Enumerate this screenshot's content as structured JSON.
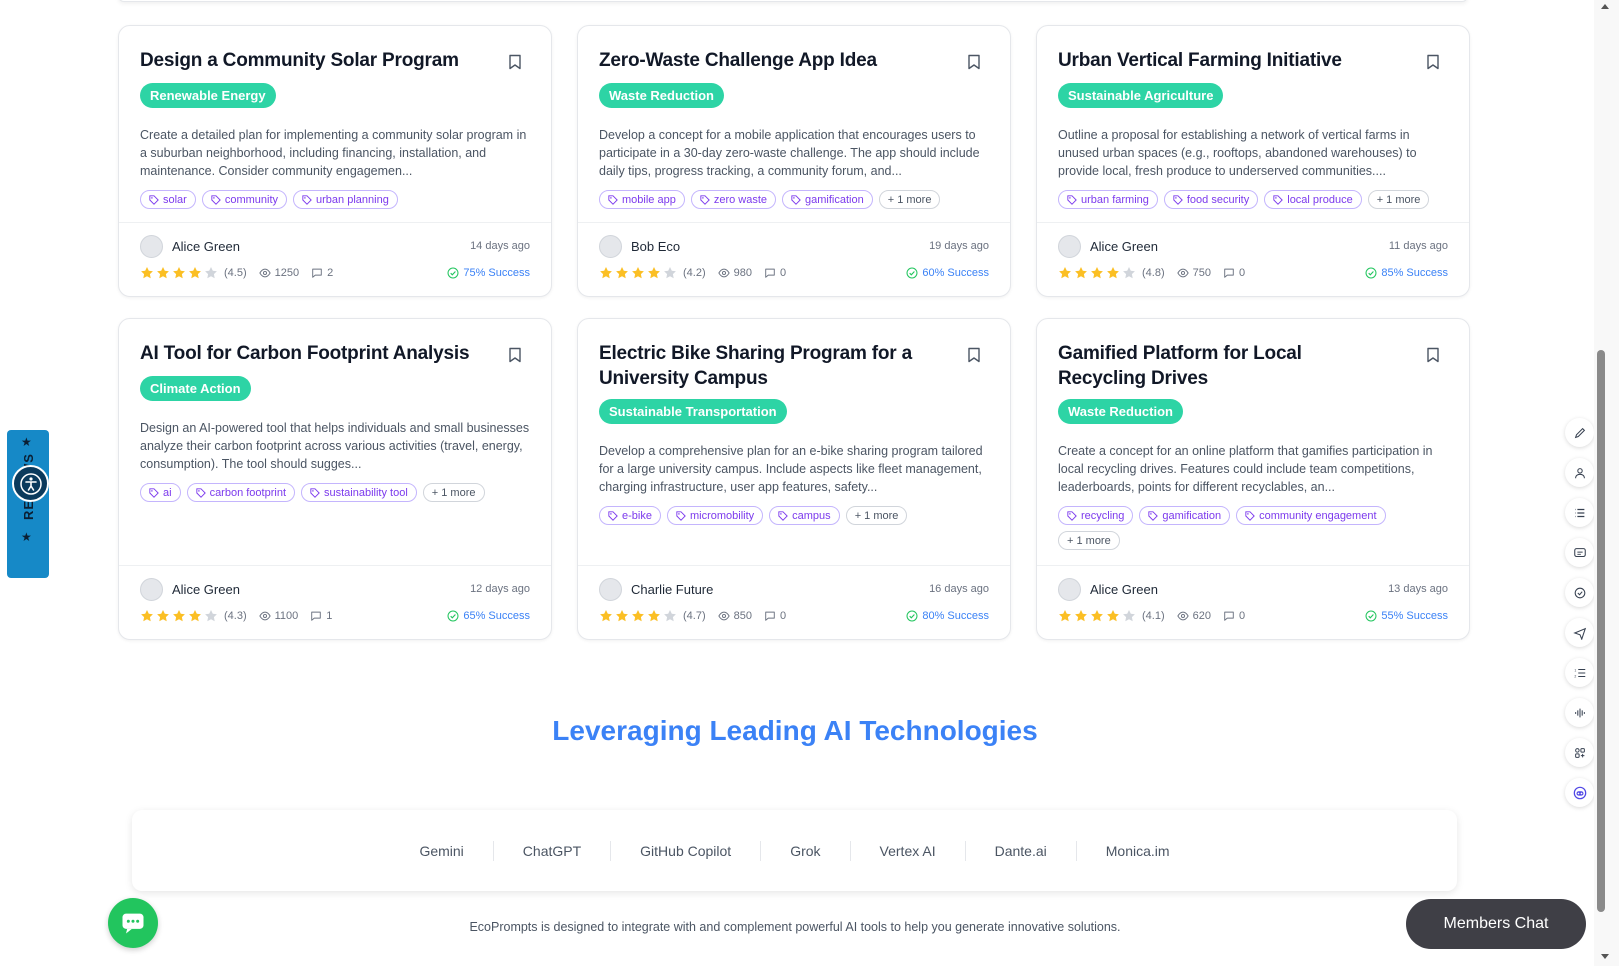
{
  "cards": [
    {
      "title": "Design a Community Solar Program",
      "category": "Renewable Energy",
      "description": "Create a detailed plan for implementing a community solar program in a suburban neighborhood, including financing, installation, and maintenance. Consider community engagemen...",
      "tags": [
        "solar",
        "community",
        "urban planning"
      ],
      "more": "",
      "author": "Alice Green",
      "date": "14 days ago",
      "rating": 4.5,
      "rating_label": "(4.5)",
      "views": "1250",
      "comments": "2",
      "success": "75% Success"
    },
    {
      "title": "Zero-Waste Challenge App Idea",
      "category": "Waste Reduction",
      "description": "Develop a concept for a mobile application that encourages users to participate in a 30-day zero-waste challenge. The app should include daily tips, progress tracking, a community forum, and...",
      "tags": [
        "mobile app",
        "zero waste",
        "gamification"
      ],
      "more": "+ 1 more",
      "author": "Bob Eco",
      "date": "19 days ago",
      "rating": 4.2,
      "rating_label": "(4.2)",
      "views": "980",
      "comments": "0",
      "success": "60% Success"
    },
    {
      "title": "Urban Vertical Farming Initiative",
      "category": "Sustainable Agriculture",
      "description": "Outline a proposal for establishing a network of vertical farms in unused urban spaces (e.g., rooftops, abandoned warehouses) to provide local, fresh produce to underserved communities....",
      "tags": [
        "urban farming",
        "food security",
        "local produce"
      ],
      "more": "+ 1 more",
      "author": "Alice Green",
      "date": "11 days ago",
      "rating": 4.8,
      "rating_label": "(4.8)",
      "views": "750",
      "comments": "0",
      "success": "85% Success"
    },
    {
      "title": "AI Tool for Carbon Footprint Analysis",
      "category": "Climate Action",
      "description": "Design an AI-powered tool that helps individuals and small businesses analyze their carbon footprint across various activities (travel, energy, consumption). The tool should sugges...",
      "tags": [
        "ai",
        "carbon footprint",
        "sustainability tool"
      ],
      "more": "+ 1 more",
      "author": "Alice Green",
      "date": "12 days ago",
      "rating": 4.3,
      "rating_label": "(4.3)",
      "views": "1100",
      "comments": "1",
      "success": "65% Success"
    },
    {
      "title": "Electric Bike Sharing Program for a University Campus",
      "category": "Sustainable Transportation",
      "description": "Develop a comprehensive plan for an e-bike sharing program tailored for a large university campus. Include aspects like fleet management, charging infrastructure, user app features, safety...",
      "tags": [
        "e-bike",
        "micromobility",
        "campus"
      ],
      "more": "+ 1 more",
      "author": "Charlie Future",
      "date": "16 days ago",
      "rating": 4.7,
      "rating_label": "(4.7)",
      "views": "850",
      "comments": "0",
      "success": "80% Success"
    },
    {
      "title": "Gamified Platform for Local Recycling Drives",
      "category": "Waste Reduction",
      "description": "Create a concept for an online platform that gamifies participation in local recycling drives. Features could include team competitions, leaderboards, points for different recyclables, an...",
      "tags": [
        "recycling",
        "gamification",
        "community engagement"
      ],
      "more": "+ 1 more",
      "author": "Alice Green",
      "date": "13 days ago",
      "rating": 4.1,
      "rating_label": "(4.1)",
      "views": "620",
      "comments": "0",
      "success": "55% Success"
    }
  ],
  "ai_section": {
    "title": "Leveraging Leading AI Technologies",
    "tools": [
      "Gemini",
      "ChatGPT",
      "GitHub Copilot",
      "Grok",
      "Vertex AI",
      "Dante.ai",
      "Monica.im"
    ],
    "note": "EcoPrompts is designed to integrate with and complement powerful AI tools to help you generate innovative solutions."
  },
  "widgets": {
    "review_label": "REVIEWS",
    "members_chat": "Members Chat"
  },
  "colors": {
    "category_bg": "#2dd4a5",
    "tag_border": "#c4b5fd",
    "tag_text": "#7c3aed",
    "accent_blue": "#3b82f6",
    "star": "#fbbf24",
    "chat_fab": "#22c55e"
  },
  "icons": [
    "bookmark-icon",
    "tag-icon",
    "star-icon",
    "eye-icon",
    "comment-icon",
    "check-circle-icon",
    "accessibility-icon",
    "chat-bubble-icon",
    "pencil-icon",
    "user-icon",
    "list-icon",
    "message-icon",
    "clock-check-icon",
    "send-icon",
    "ordered-list-icon",
    "audio-icon",
    "apps-icon",
    "bot-icon"
  ]
}
